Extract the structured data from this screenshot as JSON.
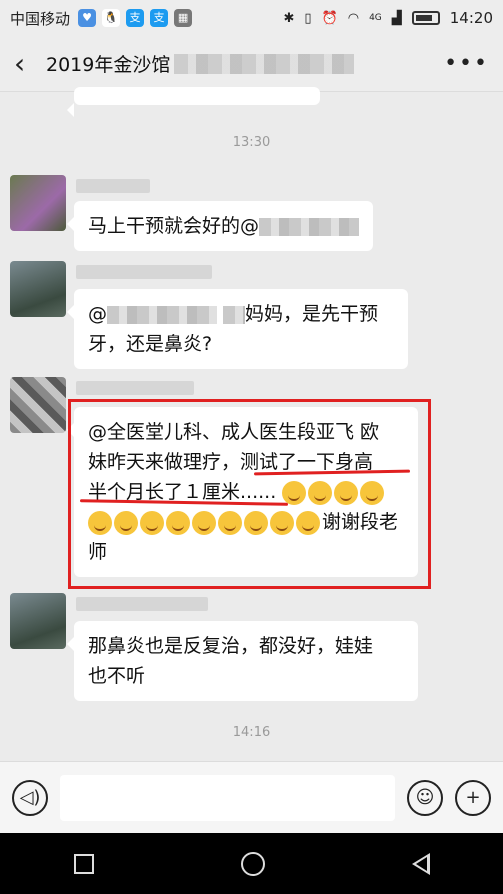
{
  "status_bar": {
    "carrier": "中国移动",
    "app_icons": [
      "wechat-icon",
      "qq-icon",
      "alipay-icon",
      "alipay-icon",
      "qr-icon"
    ],
    "network": "4G",
    "time": "14:20"
  },
  "header": {
    "title": "2019年金沙馆",
    "more_label": "•••"
  },
  "chat": {
    "time_1": "13:30",
    "time_2": "14:16",
    "messages": [
      {
        "text": "马上干预就会好的@"
      },
      {
        "text_a": "@",
        "text_b": "妈妈，是先干预",
        "text_c": "牙，还是鼻炎?"
      },
      {
        "line1": "@全医堂儿科、成人医生段亚飞  欧",
        "line2": "妹昨天来做理疗，测试了一下身高",
        "line3": "半个月长了１厘米......",
        "line4_tail": "谢谢段老",
        "line5": "师"
      },
      {
        "line1": "那鼻炎也是反复治，都没好，娃娃",
        "line2": "也不听"
      }
    ]
  },
  "colors": {
    "highlight": "#e02020",
    "bubble": "#ffffff",
    "background": "#ebebeb"
  }
}
